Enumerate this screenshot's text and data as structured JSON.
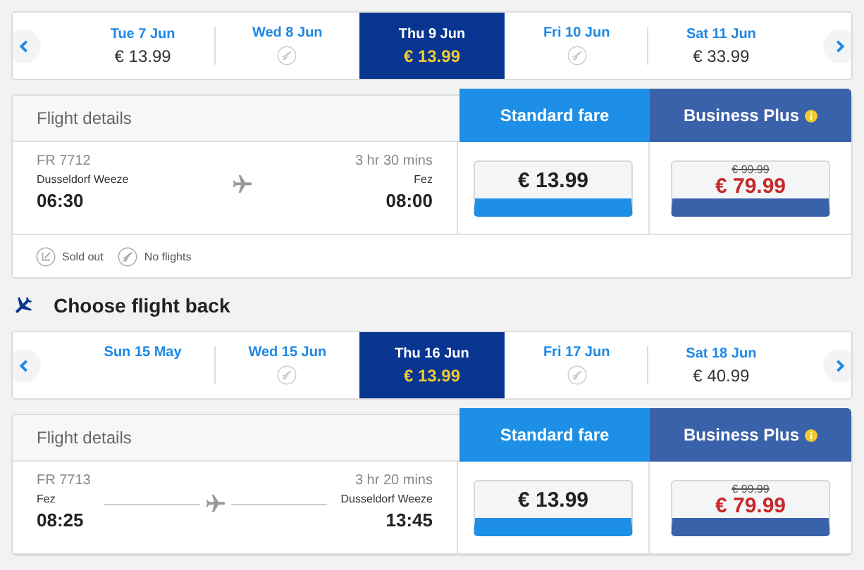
{
  "outbound": {
    "dates": [
      {
        "date": "Tue 7 Jun",
        "kind": "price",
        "price": "€ 13.99",
        "selected": false
      },
      {
        "date": "Wed 8 Jun",
        "kind": "none",
        "selected": false
      },
      {
        "date": "Thu 9 Jun",
        "kind": "price",
        "price": "€ 13.99",
        "selected": true
      },
      {
        "date": "Fri 10 Jun",
        "kind": "none",
        "selected": false
      },
      {
        "date": "Sat 11 Jun",
        "kind": "price",
        "price": "€ 33.99",
        "selected": false
      }
    ],
    "header": {
      "details": "Flight details",
      "standard": "Standard fare",
      "business": "Business Plus"
    },
    "flight": {
      "number": "FR 7712",
      "duration": "3 hr 30 mins",
      "from": "Dusseldorf Weeze",
      "to": "Fez",
      "depart": "06:30",
      "arrive": "08:00",
      "route_line": false,
      "standard_price": "€ 13.99",
      "business_old_price": "€ 99.99",
      "business_price": "€ 79.99"
    },
    "legend": [
      {
        "kind": "sold_out",
        "label": "Sold out"
      },
      {
        "kind": "no_flights",
        "label": "No flights"
      }
    ]
  },
  "heading": "Choose flight back",
  "return": {
    "dates": [
      {
        "date": "Sun 15 May",
        "kind": "blank",
        "selected": false
      },
      {
        "date": "Wed 15 Jun",
        "kind": "none",
        "selected": false
      },
      {
        "date": "Thu 16 Jun",
        "kind": "price",
        "price": "€ 13.99",
        "selected": true
      },
      {
        "date": "Fri 17 Jun",
        "kind": "none",
        "selected": false
      },
      {
        "date": "Sat 18 Jun",
        "kind": "price",
        "price": "€ 40.99",
        "selected": false
      }
    ],
    "header": {
      "details": "Flight details",
      "standard": "Standard fare",
      "business": "Business Plus"
    },
    "flight": {
      "number": "FR 7713",
      "duration": "3 hr 20 mins",
      "from": "Fez",
      "to": "Dusseldorf Weeze",
      "depart": "08:25",
      "arrive": "13:45",
      "route_line": true,
      "standard_price": "€ 13.99",
      "business_old_price": "€ 99.99",
      "business_price": "€ 79.99"
    }
  }
}
